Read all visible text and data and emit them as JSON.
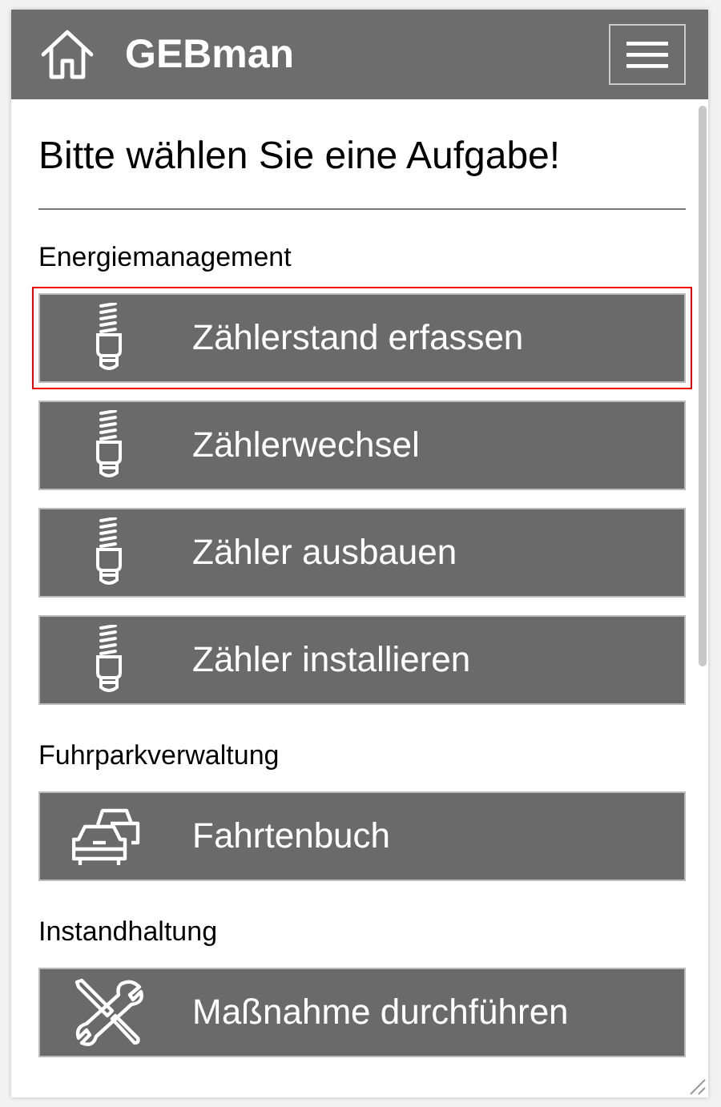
{
  "header": {
    "title": "GEBman"
  },
  "heading": "Bitte wählen Sie eine Aufgabe!",
  "sections": [
    {
      "title": "Energiemanagement",
      "items": [
        {
          "label": "Zählerstand erfassen",
          "kind": "bulb",
          "selected": true
        },
        {
          "label": "Zählerwechsel",
          "kind": "bulb",
          "selected": false
        },
        {
          "label": "Zähler ausbauen",
          "kind": "bulb",
          "selected": false
        },
        {
          "label": "Zähler installieren",
          "kind": "bulb",
          "selected": false
        }
      ]
    },
    {
      "title": "Fuhrparkverwaltung",
      "items": [
        {
          "label": "Fahrtenbuch",
          "kind": "cars",
          "selected": false
        }
      ]
    },
    {
      "title": "Instandhaltung",
      "items": [
        {
          "label": "Maßnahme durchführen",
          "kind": "tools",
          "selected": false
        }
      ]
    }
  ]
}
